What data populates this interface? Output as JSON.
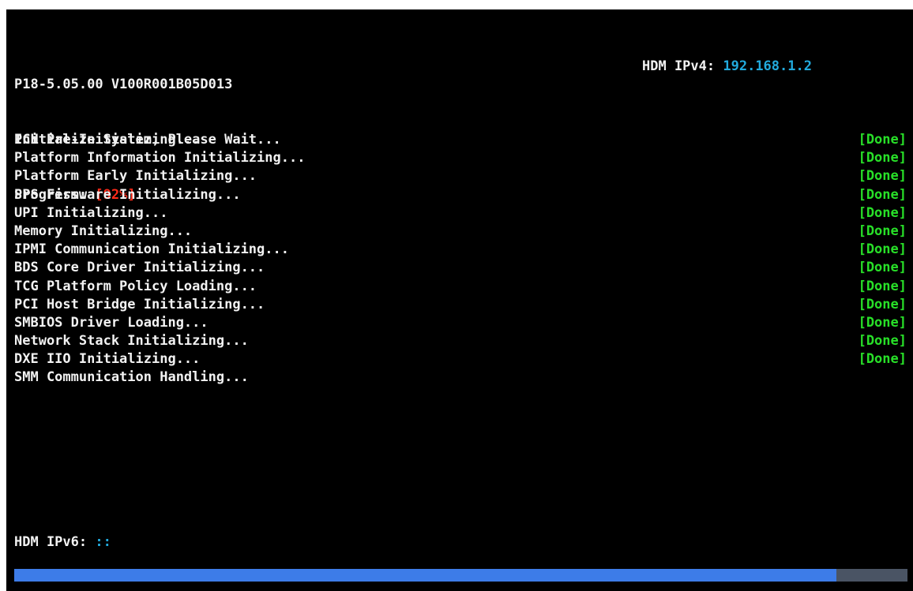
{
  "header": {
    "version": "P18-5.05.00 V100R001B05D013",
    "status": "Initialize System, Please Wait...",
    "progress_label": "Progress:",
    "progress_value": "[92%]",
    "ipv4_label": "HDM IPv4:",
    "ipv4_value": "192.168.1.2"
  },
  "steps": [
    {
      "label": "PCH Pre-Initializing...",
      "status": "[Done]"
    },
    {
      "label": "Platform Information Initializing...",
      "status": "[Done]"
    },
    {
      "label": "Platform Early Initializing...",
      "status": "[Done]"
    },
    {
      "label": "SPS Firmware Initializing...",
      "status": "[Done]"
    },
    {
      "label": "UPI Initializing...",
      "status": "[Done]"
    },
    {
      "label": "Memory Initializing...",
      "status": "[Done]"
    },
    {
      "label": "IPMI Communication Initializing...",
      "status": "[Done]"
    },
    {
      "label": "BDS Core Driver Initializing...",
      "status": "[Done]"
    },
    {
      "label": "TCG Platform Policy Loading...",
      "status": "[Done]"
    },
    {
      "label": "PCI Host Bridge Initializing...",
      "status": "[Done]"
    },
    {
      "label": "SMBIOS Driver Loading...",
      "status": "[Done]"
    },
    {
      "label": "Network Stack Initializing...",
      "status": "[Done]"
    },
    {
      "label": "DXE IIO Initializing...",
      "status": "[Done]"
    },
    {
      "label": "SMM Communication Handling...",
      "status": ""
    }
  ],
  "footer": {
    "ipv6_label": "HDM IPv6:",
    "ipv6_value": "::",
    "progress_fraction": 0.92
  },
  "colors": {
    "background": "#000000",
    "text": "#f2f2f2",
    "progress_text": "#ff2b1a",
    "ip_value": "#22aadd",
    "done": "#28e028",
    "bar_fill": "#3d7ce8",
    "bar_track": "#4a5464"
  }
}
